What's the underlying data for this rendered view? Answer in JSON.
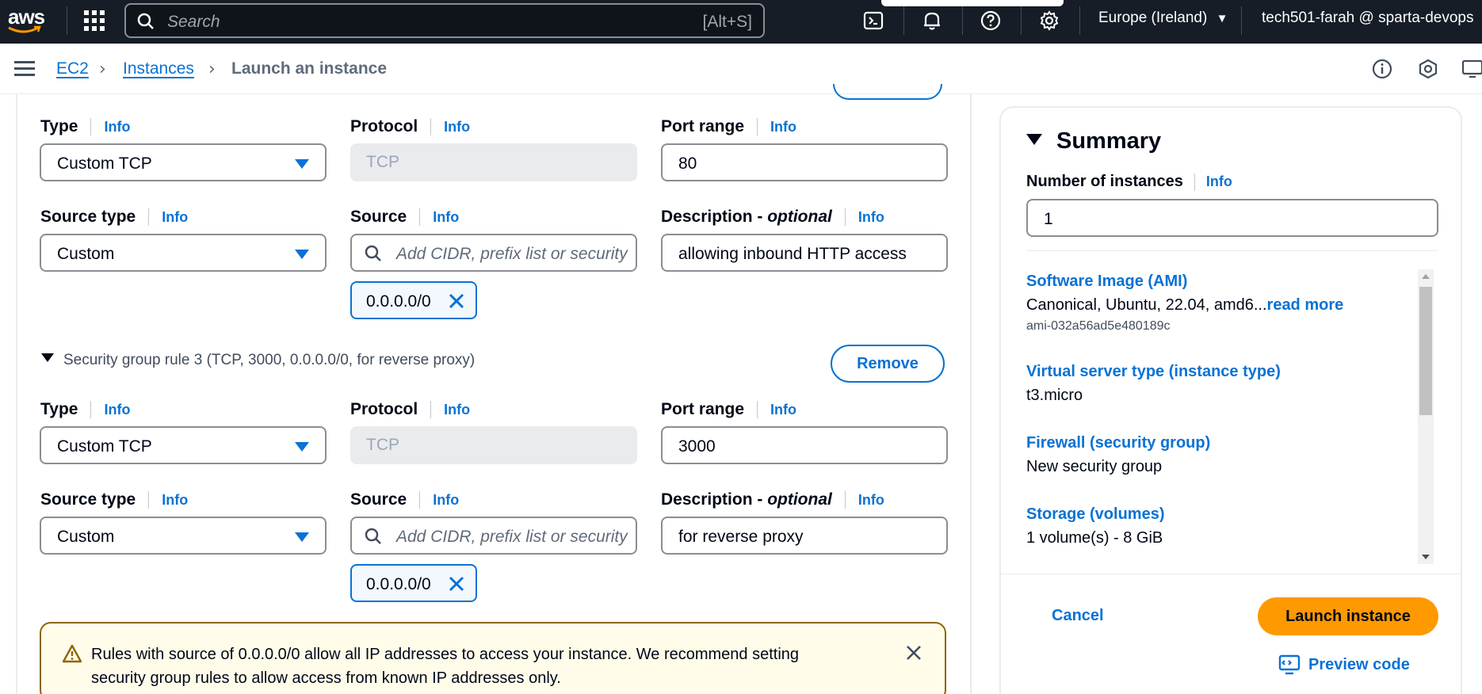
{
  "topnav": {
    "logo_text": "aws",
    "search_placeholder": "Search",
    "search_shortcut": "[Alt+S]",
    "region": "Europe (Ireland)",
    "account": "tech501-farah @ sparta-devops",
    "icons": [
      "cloudshell-icon",
      "bell-icon",
      "help-icon",
      "gear-icon"
    ]
  },
  "breadcrumb": {
    "items": [
      "EC2",
      "Instances"
    ],
    "current": "Launch an instance"
  },
  "form": {
    "info": "Info",
    "rule2": {
      "type_label": "Type",
      "type_value": "Custom TCP",
      "protocol_label": "Protocol",
      "protocol_value": "TCP",
      "port_label": "Port range",
      "port_value": "80",
      "source_type_label": "Source type",
      "source_type_value": "Custom",
      "source_label": "Source",
      "source_placeholder": "Add CIDR, prefix list or security",
      "source_token": "0.0.0.0/0",
      "desc_label_main": "Description - ",
      "desc_label_optional": "optional",
      "desc_value": "allowing inbound HTTP access"
    },
    "rule3": {
      "heading": "Security group rule 3 (TCP, 3000, 0.0.0.0/0, for reverse proxy)",
      "remove_label": "Remove",
      "type_label": "Type",
      "type_value": "Custom TCP",
      "protocol_label": "Protocol",
      "protocol_value": "TCP",
      "port_label": "Port range",
      "port_value": "3000",
      "source_type_label": "Source type",
      "source_type_value": "Custom",
      "source_label": "Source",
      "source_placeholder": "Add CIDR, prefix list or security",
      "source_token": "0.0.0.0/0",
      "desc_label_main": "Description - ",
      "desc_label_optional": "optional",
      "desc_value": "for reverse proxy"
    },
    "warning": "Rules with source of 0.0.0.0/0 allow all IP addresses to access your instance. We recommend setting security group rules to allow access from known IP addresses only."
  },
  "summary": {
    "title": "Summary",
    "instances_label": "Number of instances",
    "info": "Info",
    "instances_value": "1",
    "ami_label": "Software Image (AMI)",
    "ami_value": "Canonical, Ubuntu, 22.04, amd6...",
    "ami_more": "read more",
    "ami_id": "ami-032a56ad5e480189c",
    "type_label": "Virtual server type (instance type)",
    "type_value": "t3.micro",
    "firewall_label": "Firewall (security group)",
    "firewall_value": "New security group",
    "storage_label": "Storage (volumes)",
    "storage_value": "1 volume(s) - 8 GiB",
    "cancel_label": "Cancel",
    "launch_label": "Launch instance",
    "preview_label": "Preview code"
  },
  "colors": {
    "nav_bg": "#161d26",
    "link": "#0972d3",
    "launch": "#ff9900",
    "warning_border": "#8d6605",
    "warning_bg": "#fffce9"
  }
}
